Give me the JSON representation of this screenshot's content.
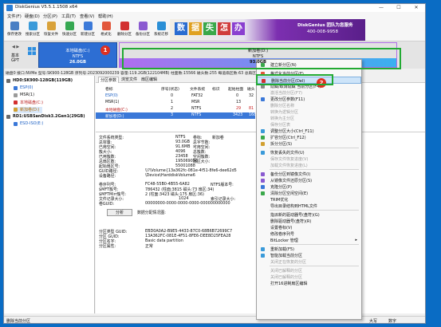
{
  "window": {
    "title": "DiskGenius V5.5.1.1508 x64",
    "controls": [
      "—",
      "☐",
      "✕"
    ]
  },
  "menu": [
    "文件(F)",
    "硬盘(D)",
    "分区(P)",
    "工具(T)",
    "查看(V)",
    "帮助(H)"
  ],
  "toolbar": [
    {
      "label": "保存更改",
      "color": "#4a7fc4"
    },
    {
      "label": "搜索分区",
      "color": "#3a9ad9"
    },
    {
      "label": "恢复文件",
      "color": "#d9a23a"
    },
    {
      "label": "快速分区",
      "color": "#36a852"
    },
    {
      "label": "新建分区",
      "color": "#3c7ad9"
    },
    {
      "label": "格式化",
      "color": "#e2573b"
    },
    {
      "label": "删除分区",
      "color": "#d23030"
    },
    {
      "label": "备份分区",
      "color": "#8a5ad0"
    },
    {
      "label": "系统迁移",
      "color": "#2b8fd6"
    }
  ],
  "banner": {
    "chars": [
      "数",
      "据",
      "失",
      "怎",
      "办"
    ],
    "char_colors": [
      "#2a6cd0",
      "#e0a020",
      "#3aa84a",
      "#d03c3c",
      "#8a3fd0"
    ],
    "slogan": "DiskGenius 团队为您服务",
    "phone": "400-008-9958"
  },
  "disk_map": {
    "nav_arrows": "◀ ▶",
    "basic_label": "基本",
    "gpt_label": "GPT",
    "partition_c": {
      "name": "本地磁盘(C:)",
      "fs": "NTFS",
      "size": "26.0GB"
    },
    "partition_d": {
      "name": "新加卷(D:)",
      "fs": "NTFS",
      "size": "93.0GB"
    }
  },
  "callouts": [
    "1",
    "2"
  ],
  "info_line": "磁盘0 接口:NVMe  型号:SK900-128GB  序列号:2023092000239  容量:119.2GB(122104MB)  柱面数:15566  磁头数:255  每道扇区数:63  总扇区",
  "tree": [
    {
      "label": "HD0:SK900-128GB(119GB)",
      "icon_color": "#6b6b6b",
      "bold": true
    },
    {
      "label": "ESP(0)",
      "icon_color": "#3a78d8"
    },
    {
      "label": "MSR(1)",
      "icon_color": "#9a9a9a"
    },
    {
      "label": "本地磁盘(C:)",
      "icon_color": "#d23030"
    },
    {
      "label": "新加卷(D:)",
      "icon_color": "#d2a030",
      "selected": true
    },
    {
      "label": "RD1:USBSanDisk3.2Gen1(29GB)",
      "icon_color": "#6b6b6b",
      "bold": true
    },
    {
      "label": "ESD-ISO(E:)",
      "icon_color": "#3a78d8"
    }
  ],
  "tabs": [
    "分区参数",
    "浏览文件",
    "扇区编辑"
  ],
  "partition_table": {
    "headers": [
      "卷标",
      "序号(状态)",
      "文件系统",
      "标识",
      "起始柱面",
      "磁头"
    ],
    "rows": [
      {
        "name": "ESP(0)",
        "seq": "0",
        "fs": "FAT32",
        "id": "",
        "cyl": "0",
        "head": "32"
      },
      {
        "name": "MSR(1)",
        "seq": "1",
        "fs": "MSR",
        "id": "",
        "cyl": "13",
        "head": ""
      },
      {
        "name": "本地磁盘(C:)",
        "seq": "2",
        "fs": "NTFS",
        "id": "",
        "cyl": "29",
        "head": "81"
      },
      {
        "name": "新加卷(D:)",
        "seq": "3",
        "fs": "NTFS",
        "id": "",
        "cyl": "3423",
        "head": "168"
      }
    ]
  },
  "props_left": [
    {
      "label": "文件系统类型:",
      "value": "NTFS"
    },
    {
      "label": "总容量:",
      "value": "93.0GB"
    },
    {
      "label": "已用空间:",
      "value": "91.6MB"
    },
    {
      "label": "簇大小:",
      "value": "4096"
    },
    {
      "label": "已用簇数:",
      "value": "23458"
    },
    {
      "label": "总扇区数:",
      "value": "195069056"
    },
    {
      "label": "起始扇区号:",
      "value": "55001088"
    },
    {
      "label": "GUID路径:",
      "value": "\\\\?\\Volume{13a362fc-081e-4f51-8fe6-dee62d5"
    },
    {
      "label": "设备路径:",
      "value": "\\Device\\HarddiskVolume6"
    }
  ],
  "props_right": [
    {
      "label": "卷标:",
      "value": "新加卷"
    },
    {
      "label": "总字节数:",
      "value": ""
    },
    {
      "label": "可用空间:",
      "value": ""
    },
    {
      "label": "总簇数:",
      "value": ""
    },
    {
      "label": "空闲簇数:",
      "value": ""
    },
    {
      "label": "扇区大小:",
      "value": ""
    }
  ],
  "props_ntfs": [
    {
      "label": "卷序列号:",
      "value": "FC48-55B0-4B55-6A82",
      "label2": "NTFS版本号:"
    },
    {
      "label": "$MFT簇号:",
      "value": "786432 (柱面:3815 磁头:73 扇区:34)"
    },
    {
      "label": "$MFTMirr簇号:",
      "value": "2 (柱面:3423 磁头:175 扇区:36)"
    },
    {
      "label": "文件记录大小:",
      "value": "1024",
      "label2": "索引记录大小:"
    },
    {
      "label": "卷GUID:",
      "value": "00000000-0000-0000-0000-000000000000"
    }
  ],
  "analyze": {
    "button": "分析",
    "hint": "数据分配情况图:"
  },
  "props_guid": [
    {
      "label": "分区类型 GUID:",
      "value": "EBD0A0A2-B9E5-4433-87C0-68B6B72699C7"
    },
    {
      "label": "分区 GUID:",
      "value": "13A362FC-081E-4F51-8FE6-DEE8D25FEA28"
    },
    {
      "label": "分区名字:",
      "value": "Basic data partition"
    },
    {
      "label": "分区属性:",
      "value": "正常"
    }
  ],
  "context_menu": [
    {
      "label": "建立新分区(N)",
      "icon": "#3aa84a",
      "state": "enabled"
    },
    {
      "sep": true
    },
    {
      "label": "格式化当前分区(F)",
      "icon": "#e2573b",
      "state": "enabled"
    },
    {
      "label": "删除当前分区(Del)",
      "icon": "#d23030",
      "state": "hover"
    },
    {
      "label": "隐藏/取消隐藏 当前分区(F4)",
      "icon": "#8a8a8a",
      "state": "enabled"
    },
    {
      "label": "激活当前分区(F7)",
      "icon": "",
      "state": "disabled"
    },
    {
      "label": "更改分区参数(F11)",
      "icon": "#3a78d8",
      "state": "enabled"
    },
    {
      "label": "删除分区名称",
      "icon": "",
      "state": "disabled"
    },
    {
      "label": "转换为逻辑分区",
      "icon": "",
      "state": "disabled"
    },
    {
      "label": "转换为主分区",
      "icon": "",
      "state": "disabled"
    },
    {
      "label": "保存分区表",
      "icon": "",
      "state": "disabled"
    },
    {
      "label": "调整分区大小(Ctrl_F11)",
      "icon": "#3a9ad9",
      "state": "enabled"
    },
    {
      "label": "扩容分区(Ctrl_F12)",
      "icon": "#3aa84a",
      "state": "enabled"
    },
    {
      "label": "拆分分区(S)",
      "icon": "#d2a030",
      "state": "enabled"
    },
    {
      "sep": true
    },
    {
      "label": "恢复丢失的文件(U)",
      "icon": "#3a9ad9",
      "state": "enabled"
    },
    {
      "label": "保存文件恢复进度(V)",
      "icon": "",
      "state": "disabled"
    },
    {
      "label": "加载文件恢复进度(L)",
      "icon": "",
      "state": "disabled"
    },
    {
      "sep": true
    },
    {
      "label": "备份分区到镜像文件(I)",
      "icon": "#8a5ad0",
      "state": "enabled"
    },
    {
      "label": "从镜像文件还原分区(S)",
      "icon": "#8a5ad0",
      "state": "enabled"
    },
    {
      "label": "克隆分区(P)",
      "icon": "#3a78d8",
      "state": "enabled"
    },
    {
      "label": "清除分区空闲空间(E)",
      "icon": "#3aa84a",
      "state": "enabled"
    },
    {
      "label": "TRIM优化",
      "icon": "",
      "state": "enabled"
    },
    {
      "label": "导出目录结构到HTML文件",
      "icon": "",
      "state": "enabled"
    },
    {
      "sep": true
    },
    {
      "label": "指派新的驱动器号(盘符)(G)",
      "icon": "",
      "state": "enabled"
    },
    {
      "label": "删除驱动器号(盘符)(R)",
      "icon": "",
      "state": "enabled"
    },
    {
      "label": "设置卷标(V)",
      "icon": "",
      "state": "enabled"
    },
    {
      "label": "修改卷序列号",
      "icon": "",
      "state": "enabled"
    },
    {
      "label": "BitLocker 管理",
      "icon": "",
      "state": "enabled",
      "submenu": true
    },
    {
      "sep": true
    },
    {
      "label": "重新加载(F5)",
      "icon": "#3a9ad9",
      "state": "enabled"
    },
    {
      "label": "智能加载当前分区",
      "icon": "#3a9ad9",
      "state": "enabled"
    },
    {
      "label": "关闭正在恢复的分区",
      "icon": "",
      "state": "disabled"
    },
    {
      "sep": true
    },
    {
      "label": "关闭已解释的分区",
      "icon": "",
      "state": "disabled"
    },
    {
      "label": "关闭已解释的分区",
      "icon": "",
      "state": "disabled"
    },
    {
      "label": "打开16进制扇区编辑",
      "icon": "",
      "state": "enabled"
    }
  ],
  "status": {
    "left": "删除当前分区",
    "caps": "大写",
    "num": "数字"
  }
}
